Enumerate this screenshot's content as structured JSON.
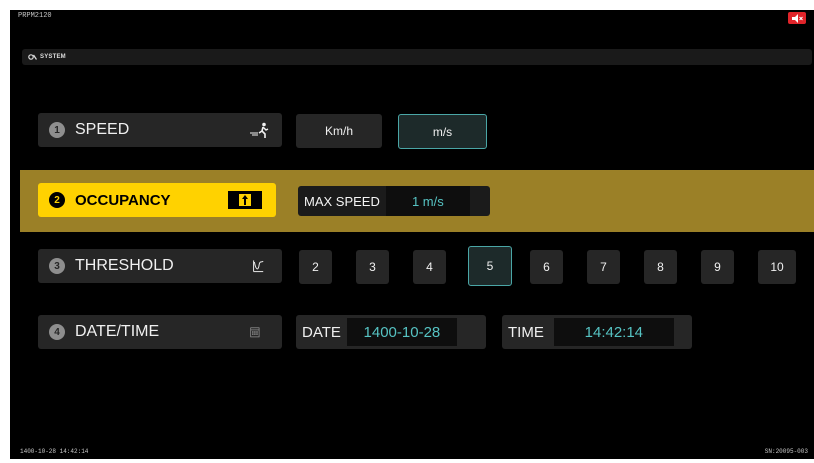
{
  "device": {
    "id": "PRPM2120"
  },
  "colors": {
    "accent": "#ffd200",
    "band": "#9b8027",
    "value": "#56c3c3",
    "mute": "#e0242a"
  },
  "header": {
    "title": "SYSTEM",
    "icon": "gear-wrench-icon"
  },
  "settings": [
    {
      "number": "1",
      "label": "SPEED",
      "icon": "walking-person-icon"
    },
    {
      "number": "2",
      "label": "OCCUPANCY",
      "icon": "door-exit-icon"
    },
    {
      "number": "3",
      "label": "THRESHOLD",
      "icon": "waveform-icon"
    },
    {
      "number": "4",
      "label": "DATE/TIME",
      "icon": "calendar-icon"
    }
  ],
  "speed_units": {
    "options": [
      "Km/h",
      "m/s"
    ],
    "selected": "m/s"
  },
  "occupancy": {
    "max_speed_label": "MAX SPEED",
    "max_speed_value": "1 m/s"
  },
  "threshold": {
    "options": [
      "2",
      "3",
      "4",
      "5",
      "6",
      "7",
      "8",
      "9",
      "10"
    ],
    "selected": "5"
  },
  "datetime": {
    "date_label": "DATE",
    "date_value": "1400-10-28",
    "time_label": "TIME",
    "time_value": "14:42:14"
  },
  "footer": {
    "timestamp": "1400-10-28 14:42:14",
    "serial": "SN:20095-003"
  }
}
